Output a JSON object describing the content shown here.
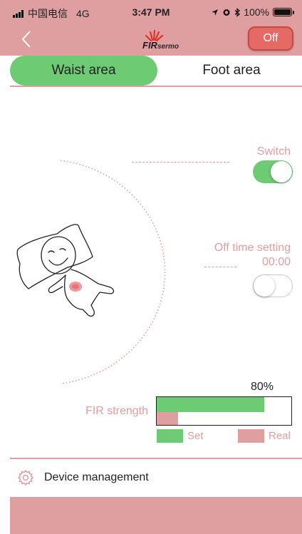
{
  "status_bar": {
    "carrier": "中国电信",
    "network": "4G",
    "time": "3:47 PM",
    "battery": "100%"
  },
  "header": {
    "logo_brand": "FIR",
    "logo_suffix": "sermo",
    "off_button": "Off"
  },
  "tabs": [
    {
      "label": "Waist area",
      "selected": true
    },
    {
      "label": "Foot area",
      "selected": false
    }
  ],
  "controls": {
    "switch_label": "Switch",
    "switch_on": true,
    "off_time_label": "Off time setting",
    "off_time_value": "00:00",
    "off_time_enabled": false
  },
  "strength": {
    "label": "FIR strength",
    "percent_text": "80%",
    "set_level": 0.8,
    "real_level": 0.16,
    "legend_set": "Set",
    "legend_real": "Real"
  },
  "device_management": {
    "label": "Device management",
    "icon": "gear-icon"
  },
  "colors": {
    "accent_pink": "#df9ea0",
    "accent_green": "#6ccb73",
    "off_red": "#e46a65"
  }
}
